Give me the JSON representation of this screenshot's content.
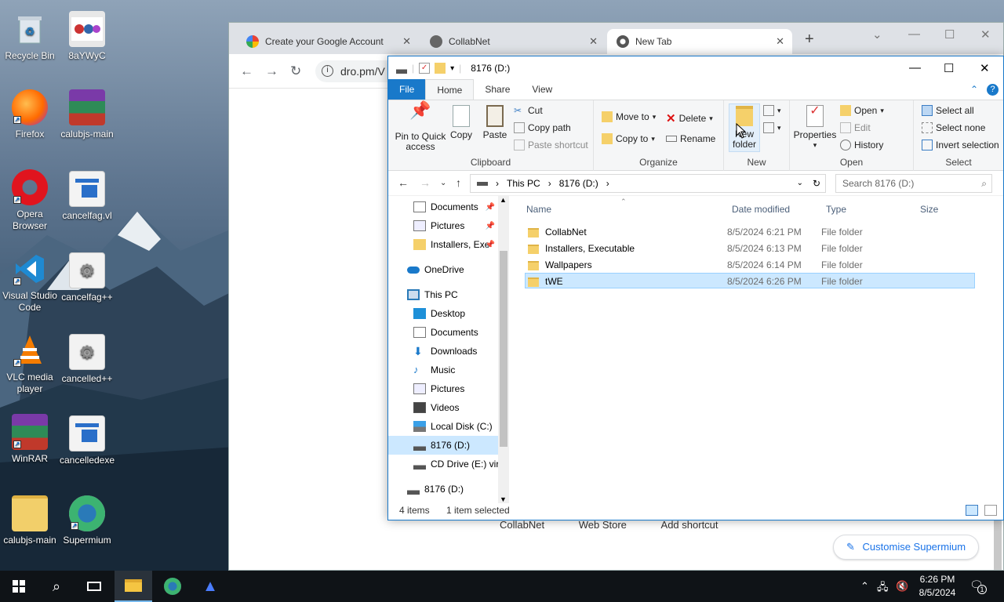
{
  "desktop": {
    "icons": [
      {
        "label": "Recycle Bin",
        "icon": "recycle-bin-icon"
      },
      {
        "label": "8aYWyC",
        "icon": "image-file-icon"
      },
      {
        "label": "Firefox",
        "icon": "firefox-icon"
      },
      {
        "label": "calubjs-main",
        "icon": "winrar-archive-icon"
      },
      {
        "label": "Opera Browser",
        "icon": "opera-icon"
      },
      {
        "label": "cancelfag.vl",
        "icon": "document-icon"
      },
      {
        "label": "Visual Studio Code",
        "icon": "vscode-icon"
      },
      {
        "label": "cancelfag++",
        "icon": "settings-file-icon"
      },
      {
        "label": "VLC media player",
        "icon": "vlc-icon"
      },
      {
        "label": "cancelled++",
        "icon": "settings-file-icon"
      },
      {
        "label": "WinRAR",
        "icon": "winrar-icon"
      },
      {
        "label": "cancelledexe",
        "icon": "document-icon"
      },
      {
        "label": "calubjs-main",
        "icon": "folder-zip-icon"
      },
      {
        "label": "Supermium",
        "icon": "supermium-icon"
      }
    ]
  },
  "browser": {
    "tabs": [
      {
        "title": "Create your Google Account"
      },
      {
        "title": "CollabNet"
      },
      {
        "title": "New Tab"
      }
    ],
    "new_tab_glyph": "+",
    "url": "dro.pm/V",
    "shortcuts": [
      "CollabNet",
      "Web Store",
      "Add shortcut"
    ],
    "customise_label": "Customise Supermium"
  },
  "explorer": {
    "title": "8176 (D:)",
    "ribbon_tabs": [
      "File",
      "Home",
      "Share",
      "View"
    ],
    "clipboard": {
      "pin": "Pin to Quick access",
      "copy": "Copy",
      "paste": "Paste",
      "cut": "Cut",
      "copy_path": "Copy path",
      "paste_shortcut": "Paste shortcut",
      "label": "Clipboard"
    },
    "organize": {
      "move_to": "Move to",
      "copy_to": "Copy to",
      "delete": "Delete",
      "rename": "Rename",
      "label": "Organize"
    },
    "new": {
      "new_folder": "New folder",
      "label": "New"
    },
    "open": {
      "properties": "Properties",
      "open": "Open",
      "edit": "Edit",
      "history": "History",
      "label": "Open"
    },
    "select": {
      "select_all": "Select all",
      "select_none": "Select none",
      "invert": "Invert selection",
      "label": "Select"
    },
    "breadcrumb": [
      "This PC",
      "8176 (D:)"
    ],
    "search_placeholder": "Search 8176 (D:)",
    "nav_items": [
      {
        "label": "Documents",
        "pinned": true
      },
      {
        "label": "Pictures",
        "pinned": true
      },
      {
        "label": "Installers, Exe",
        "pinned": true
      },
      {
        "label": "OneDrive"
      },
      {
        "label": "This PC"
      },
      {
        "label": "Desktop"
      },
      {
        "label": "Documents"
      },
      {
        "label": "Downloads"
      },
      {
        "label": "Music"
      },
      {
        "label": "Pictures"
      },
      {
        "label": "Videos"
      },
      {
        "label": "Local Disk (C:)"
      },
      {
        "label": "8176 (D:)"
      },
      {
        "label": "CD Drive (E:) virt"
      },
      {
        "label": "8176 (D:)"
      }
    ],
    "columns": [
      "Name",
      "Date modified",
      "Type",
      "Size"
    ],
    "files": [
      {
        "name": "CollabNet",
        "date": "8/5/2024 6:21 PM",
        "type": "File folder",
        "size": ""
      },
      {
        "name": "Installers, Executable",
        "date": "8/5/2024 6:13 PM",
        "type": "File folder",
        "size": ""
      },
      {
        "name": "Wallpapers",
        "date": "8/5/2024 6:14 PM",
        "type": "File folder",
        "size": ""
      },
      {
        "name": "tWE",
        "date": "8/5/2024 6:26 PM",
        "type": "File folder",
        "size": ""
      }
    ],
    "selected_file": "tWE",
    "status": {
      "count": "4 items",
      "selected": "1 item selected"
    }
  },
  "taskbar": {
    "time": "6:26 PM",
    "date": "8/5/2024",
    "notification_count": "1"
  },
  "colors": {
    "accent": "#1979ca",
    "selection": "#cce8ff",
    "taskbar": "#0f1317"
  }
}
